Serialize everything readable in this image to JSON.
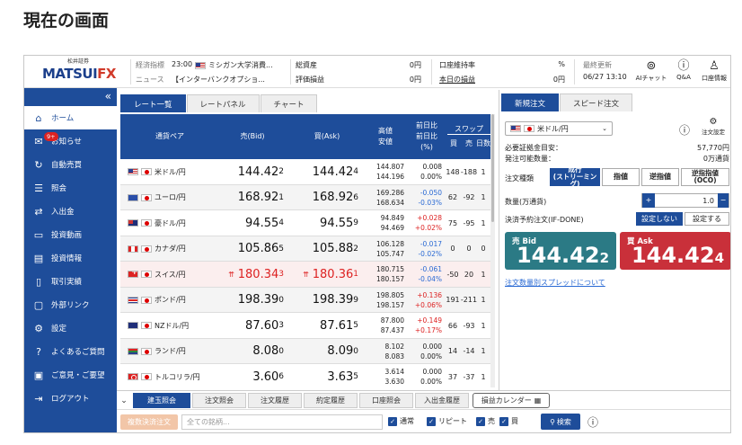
{
  "page_heading": "現在の画面",
  "header": {
    "logo_small": "松井証券",
    "logo_main_a": "MATSUI",
    "logo_main_b": "FX",
    "econ_label": "経済指標",
    "econ_time": "23:00",
    "econ_text": "ミシガン大学消費...",
    "news_label": "ニュース",
    "news_text": "【インターバンクオプショ...",
    "total_assets_label": "総資産",
    "total_assets_value": "0円",
    "pl_label": "評価損益",
    "pl_value": "0円",
    "maint_label": "口座維持率",
    "maint_value": "%",
    "today_pl_label": "本日の損益",
    "today_pl_value": "0円",
    "last_update_label": "最終更新",
    "last_update_value": "06/27 13:10",
    "icons": [
      {
        "label": "AIチャット",
        "icon": "robot-icon"
      },
      {
        "label": "Q&A",
        "icon": "question-icon"
      },
      {
        "label": "口座情報",
        "icon": "user-icon"
      }
    ]
  },
  "sidebar": {
    "items": [
      {
        "label": "ホーム",
        "icon": "home-icon",
        "active": true
      },
      {
        "label": "お知らせ",
        "icon": "mail-icon",
        "badge": "9+"
      },
      {
        "label": "自動売買",
        "icon": "auto-trade-icon"
      },
      {
        "label": "照会",
        "icon": "list-icon"
      },
      {
        "label": "入出金",
        "icon": "transfer-icon"
      },
      {
        "label": "投資動画",
        "icon": "video-icon"
      },
      {
        "label": "投資情報",
        "icon": "news-icon"
      },
      {
        "label": "取引実績",
        "icon": "document-icon"
      },
      {
        "label": "外部リンク",
        "icon": "monitor-icon"
      },
      {
        "label": "設定",
        "icon": "gear-icon"
      },
      {
        "label": "よくあるご質問",
        "icon": "question-icon"
      },
      {
        "label": "ご意見・ご要望",
        "icon": "comment-icon"
      },
      {
        "label": "ログアウト",
        "icon": "logout-icon"
      }
    ]
  },
  "main_tabs": [
    "レート一覧",
    "レートパネル",
    "チャート"
  ],
  "rate_table": {
    "headers": {
      "pair": "通貨ペア",
      "bid": "売(Bid)",
      "ask": "買(Ask)",
      "hilo": "高値",
      "hilo2": "安値",
      "prev": "前日比",
      "prev2": "前日比",
      "prev3": "(%)",
      "swap": "スワップ",
      "swap_buy": "買",
      "swap_sell": "売",
      "swap_days": "日数"
    },
    "rows": [
      {
        "flag": "us",
        "pair": "米ドル/円",
        "bid_main": "144.42",
        "bid_small": "2",
        "ask_main": "144.42",
        "ask_small": "4",
        "high": "144.807",
        "low": "144.196",
        "chg": "0.008",
        "chg_pct": "0.00%",
        "dir": "",
        "swap_buy": "148",
        "swap_sell": "-188",
        "days": "1"
      },
      {
        "flag": "eu",
        "pair": "ユーロ/円",
        "bid_main": "168.92",
        "bid_small": "1",
        "ask_main": "168.92",
        "ask_small": "6",
        "high": "169.286",
        "low": "168.634",
        "chg": "-0.050",
        "chg_pct": "-0.03%",
        "dir": "neg",
        "swap_buy": "62",
        "swap_sell": "-92",
        "days": "1"
      },
      {
        "flag": "au",
        "pair": "豪ドル/円",
        "bid_main": "94.55",
        "bid_small": "4",
        "ask_main": "94.55",
        "ask_small": "9",
        "high": "94.849",
        "low": "94.469",
        "chg": "+0.028",
        "chg_pct": "+0.02%",
        "dir": "pos",
        "swap_buy": "75",
        "swap_sell": "-95",
        "days": "1"
      },
      {
        "flag": "ca",
        "pair": "カナダ/円",
        "bid_main": "105.86",
        "bid_small": "5",
        "ask_main": "105.88",
        "ask_small": "2",
        "high": "106.128",
        "low": "105.747",
        "chg": "-0.017",
        "chg_pct": "-0.02%",
        "dir": "neg",
        "swap_buy": "0",
        "swap_sell": "0",
        "days": "0"
      },
      {
        "flag": "ch",
        "pair": "スイス/円",
        "bid_main": "180.34",
        "bid_small": "3",
        "ask_main": "180.36",
        "ask_small": "1",
        "high": "180.715",
        "low": "180.157",
        "chg": "-0.061",
        "chg_pct": "-0.04%",
        "dir": "neg",
        "swap_buy": "-50",
        "swap_sell": "20",
        "days": "1",
        "up": true
      },
      {
        "flag": "gb",
        "pair": "ポンド/円",
        "bid_main": "198.39",
        "bid_small": "0",
        "ask_main": "198.39",
        "ask_small": "9",
        "high": "198.805",
        "low": "198.157",
        "chg": "+0.136",
        "chg_pct": "+0.06%",
        "dir": "pos",
        "swap_buy": "191",
        "swap_sell": "-211",
        "days": "1"
      },
      {
        "flag": "nz",
        "pair": "NZドル/円",
        "bid_main": "87.60",
        "bid_small": "3",
        "ask_main": "87.61",
        "ask_small": "5",
        "high": "87.800",
        "low": "87.437",
        "chg": "+0.149",
        "chg_pct": "+0.17%",
        "dir": "pos",
        "swap_buy": "66",
        "swap_sell": "-93",
        "days": "1"
      },
      {
        "flag": "za",
        "pair": "ランド/円",
        "bid_main": "8.08",
        "bid_small": "0",
        "ask_main": "8.09",
        "ask_small": "0",
        "high": "8.102",
        "low": "8.083",
        "chg": "0.000",
        "chg_pct": "0.00%",
        "dir": "",
        "swap_buy": "14",
        "swap_sell": "-14",
        "days": "1"
      },
      {
        "flag": "tr",
        "pair": "トルコリラ/円",
        "bid_main": "3.60",
        "bid_small": "6",
        "ask_main": "3.63",
        "ask_small": "5",
        "high": "3.614",
        "low": "3.630",
        "chg": "0.000",
        "chg_pct": "0.00%",
        "dir": "",
        "swap_buy": "37",
        "swap_sell": "-37",
        "days": "1"
      }
    ]
  },
  "order_panel": {
    "tabs": [
      "新規注文",
      "スピード注文"
    ],
    "pair_select": "米ドル/円",
    "settings_label": "注文設定",
    "margin_label": "必要証拠金目安：",
    "margin_value": "57,770円",
    "avail_label": "発注可能数量：",
    "avail_value": "0万通貨",
    "type_label": "注文種類",
    "types": [
      "成行\n(ストリーミング)",
      "指値",
      "逆指値",
      "逆指指値\n(OCO)"
    ],
    "qty_label": "数量(万通貨)",
    "qty_value": "1.0",
    "ifdone_label": "決済予約注文(IF-DONE)",
    "ifdone_off": "設定しない",
    "ifdone_on": "設定する",
    "sell_label": "売 Bid",
    "sell_main": "144.42",
    "sell_small": "2",
    "buy_label": "買 Ask",
    "buy_main": "144.42",
    "buy_small": "4",
    "spread_link": "注文数量別スプレッドについて"
  },
  "bottom_tabs": [
    "建玉照会",
    "注文照会",
    "注文履歴",
    "約定履歴",
    "口座照会",
    "入出金履歴",
    "損益カレンダー"
  ],
  "bottom_bar": {
    "bulk_button": "複数決済注文",
    "search_placeholder": "全ての銘柄...",
    "checks": [
      "通常",
      "リピート",
      "売",
      "買"
    ],
    "search_button": "検索"
  },
  "colors": {
    "primary": "#1e4d9a",
    "sell": "#2b7a85",
    "buy": "#c9303a"
  }
}
